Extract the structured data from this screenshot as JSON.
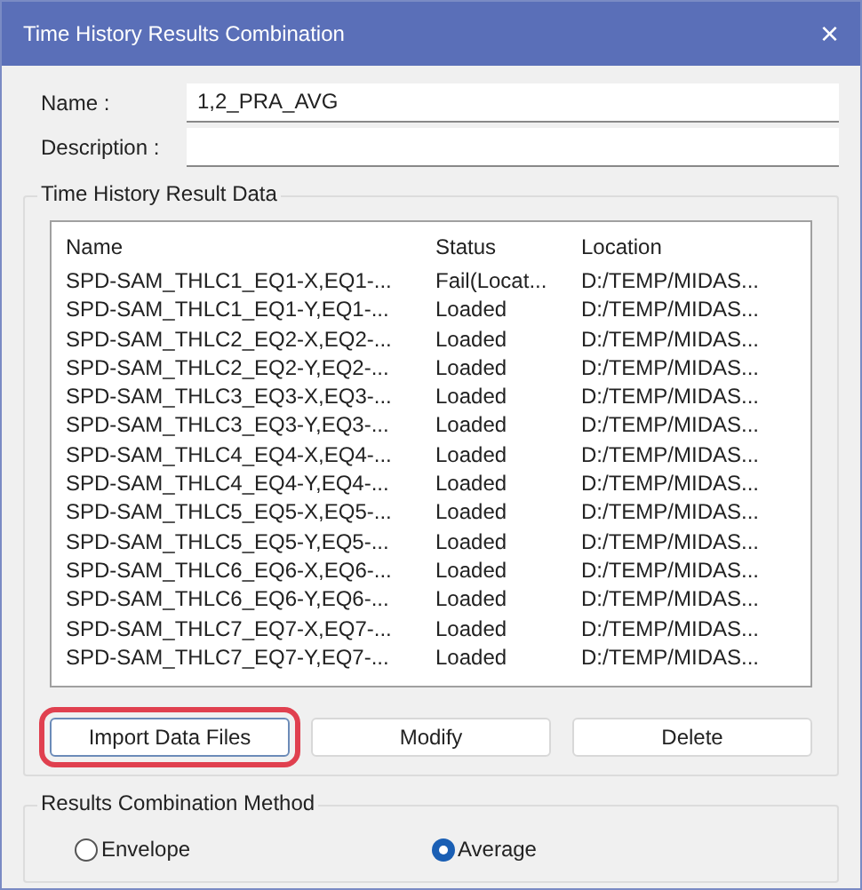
{
  "window": {
    "title": "Time History Results Combination",
    "close": "×"
  },
  "fields": [
    {
      "label": "Name :",
      "value": "1,2_PRA_AVG"
    },
    {
      "label": "Description :"
    }
  ],
  "result_data": {
    "title": "Time History Result Data",
    "columns": [
      "Name",
      "Status",
      "Location"
    ],
    "rows": [
      [
        "SPD-SAM_THLC1_EQ1-X,EQ1-...",
        "Fail(Locat...",
        "D:/TEMP/MIDAS..."
      ],
      [
        "SPD-SAM_THLC1_EQ1-Y,EQ1-...",
        "Loaded",
        "D:/TEMP/MIDAS..."
      ],
      [
        "SPD-SAM_THLC2_EQ2-X,EQ2-...",
        "Loaded",
        "D:/TEMP/MIDAS..."
      ],
      [
        "SPD-SAM_THLC2_EQ2-Y,EQ2-...",
        "Loaded",
        "D:/TEMP/MIDAS..."
      ],
      [
        "SPD-SAM_THLC3_EQ3-X,EQ3-...",
        "Loaded",
        "D:/TEMP/MIDAS..."
      ],
      [
        "SPD-SAM_THLC3_EQ3-Y,EQ3-...",
        "Loaded",
        "D:/TEMP/MIDAS..."
      ],
      [
        "SPD-SAM_THLC4_EQ4-X,EQ4-...",
        "Loaded",
        "D:/TEMP/MIDAS..."
      ],
      [
        "SPD-SAM_THLC4_EQ4-Y,EQ4-...",
        "Loaded",
        "D:/TEMP/MIDAS..."
      ],
      [
        "SPD-SAM_THLC5_EQ5-X,EQ5-...",
        "Loaded",
        "D:/TEMP/MIDAS..."
      ],
      [
        "SPD-SAM_THLC5_EQ5-Y,EQ5-...",
        "Loaded",
        "D:/TEMP/MIDAS..."
      ],
      [
        "SPD-SAM_THLC6_EQ6-X,EQ6-...",
        "Loaded",
        "D:/TEMP/MIDAS..."
      ],
      [
        "SPD-SAM_THLC6_EQ6-Y,EQ6-...",
        "Loaded",
        "D:/TEMP/MIDAS..."
      ],
      [
        "SPD-SAM_THLC7_EQ7-X,EQ7-...",
        "Loaded",
        "D:/TEMP/MIDAS..."
      ],
      [
        "SPD-SAM_THLC7_EQ7-Y,EQ7-...",
        "Loaded",
        "D:/TEMP/MIDAS..."
      ]
    ],
    "buttons": [
      {
        "label": "Import Data Files",
        "highlighted": true
      },
      {
        "label": "Modify",
        "highlighted": false
      },
      {
        "label": "Delete",
        "highlighted": false
      }
    ]
  },
  "method": {
    "title": "Results Combination Method",
    "options": [
      {
        "label": "Envelope",
        "selected": false
      },
      {
        "label": "Average",
        "selected": true
      }
    ]
  }
}
